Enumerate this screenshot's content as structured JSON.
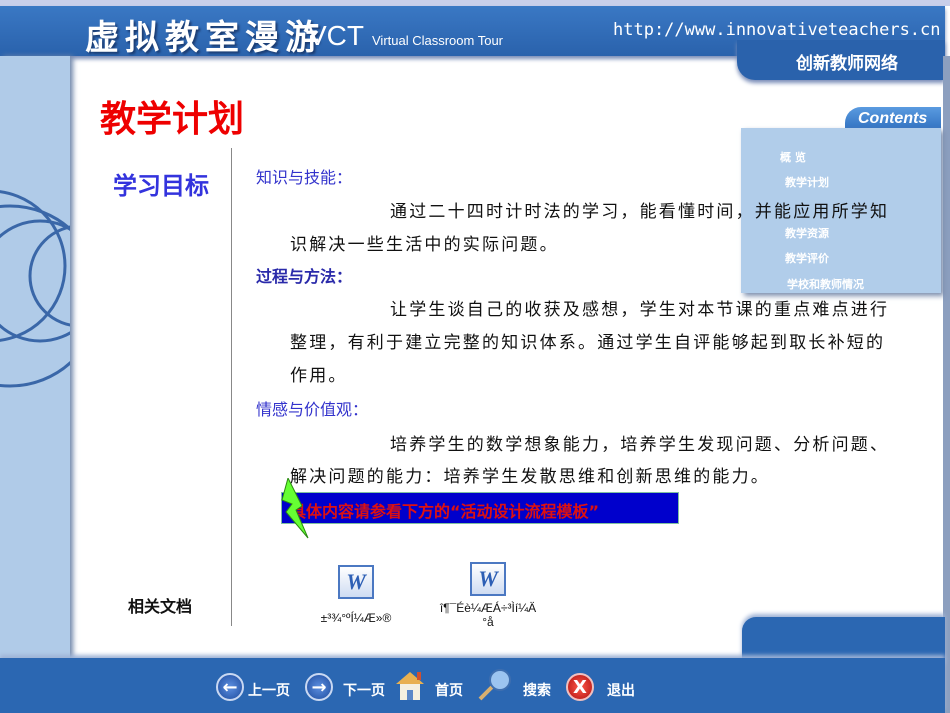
{
  "header": {
    "title": "虚拟教室漫游",
    "vct": "VCT",
    "subtitle": "Virtual Classroom Tour",
    "url": "http://www.innovativeteachers.cn",
    "site_name": "创新教师网络"
  },
  "page_title": "教学计划",
  "contents": {
    "label": "Contents",
    "items": [
      "概 览",
      "教学计划",
      "教学资源",
      "教学评价",
      "学校和教师情况"
    ]
  },
  "section": {
    "title": "学习目标",
    "blocks": [
      {
        "heading": "知识与技能：",
        "lines": [
          "通过二十四时计时法的学习，能看懂时间，并能应用所学知",
          "识解决一些生活中的实际问题。"
        ]
      },
      {
        "heading": "过程与方法：",
        "lines": [
          "让学生谈自己的收获及感想，学生对本节课的重点难点进行",
          "整理，有利于建立完整的知识体系。通过学生自评能够起到取长补短的",
          "作用。"
        ]
      },
      {
        "heading": "情感与价值观：",
        "lines": [
          "培养学生的数学想象能力，培养学生发现问题、分析问题、",
          "解决问题的能力：培养学生发散思维和创新思维的能力。"
        ]
      }
    ],
    "callout": "具体内容请参看下方的“活动设计流程模板”"
  },
  "related": {
    "label": "相关文档",
    "docs": [
      {
        "icon": "W",
        "name": "±³¾°ºÍ¼Æ»®"
      },
      {
        "icon": "W",
        "name": "î¶¯Éè¼ÆÁ÷³Ìí¼Ä",
        "name2": "°å"
      }
    ]
  },
  "footer": {
    "prev": "上一页",
    "next": "下一页",
    "home": "首页",
    "search": "搜索",
    "exit": "退出"
  },
  "colors": {
    "header": "#2a62ac",
    "title": "#ee0000",
    "heading": "#3333cc",
    "callout_bg": "#0000cc",
    "callout_text": "#dd1111"
  }
}
